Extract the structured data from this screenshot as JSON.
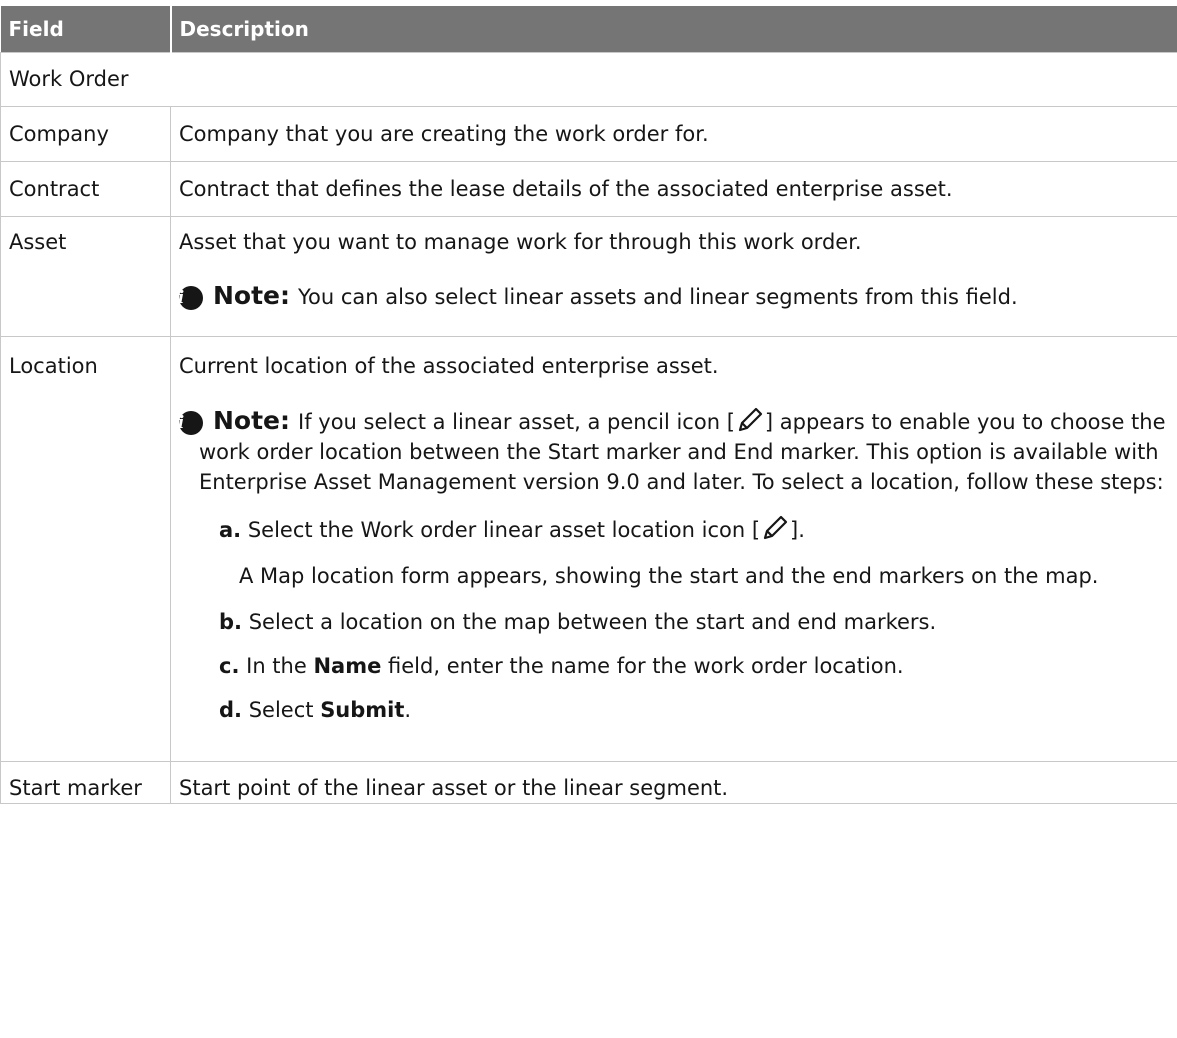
{
  "header": {
    "field": "Field",
    "description": "Description"
  },
  "section_title": "Work Order",
  "rows": {
    "company": {
      "field": "Company",
      "description": "Company that you are creating the work order for."
    },
    "contract": {
      "field": "Contract",
      "description": "Contract that defines the lease details of the associated enterprise asset."
    },
    "asset": {
      "field": "Asset",
      "description": "Asset that you want to manage work for through this work order.",
      "note_label": "Note:",
      "note_text": "You can also select linear assets and linear segments from this field."
    },
    "location": {
      "field": "Location",
      "description": "Current location of the associated enterprise asset.",
      "note_label": "Note:",
      "note_text_1": "If you select a linear asset, a pencil icon [",
      "note_text_2": "] appears to enable you to choose the work order location between the Start marker and End marker. This option is available with Enterprise Asset Management version 9.0 and later. To select a location, follow these steps:",
      "steps": {
        "a_letter": "a.",
        "a_text_1": "Select the Work order linear asset location icon [",
        "a_text_2": "].",
        "a_result": "A Map location form appears, showing the start and the end markers on the map.",
        "b_letter": "b.",
        "b_text": "Select a location on the map between the start and end markers.",
        "c_letter": "c.",
        "c_text_1": "In the",
        "c_bold": "Name",
        "c_text_2": "field, enter the name for the work order location.",
        "d_letter": "d.",
        "d_text_1": "Select",
        "d_bold": "Submit",
        "d_text_2": "."
      }
    },
    "start_marker": {
      "field": "Start marker",
      "description": "Start point of the linear asset or the linear segment."
    }
  },
  "icons": {
    "info": "info-icon",
    "pencil": "pencil-icon"
  },
  "colors": {
    "header_bg": "#757575",
    "header_text": "#ffffff",
    "border": "#c8c8c8"
  }
}
